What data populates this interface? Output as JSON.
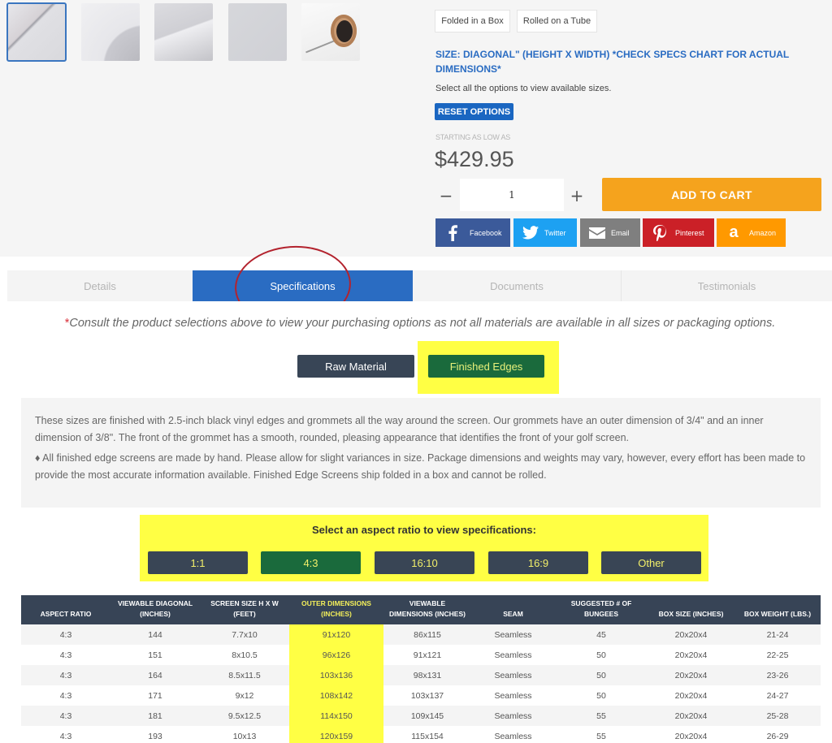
{
  "gallery": {
    "thumbnails": [
      {
        "alt": "folded screen material close-up",
        "active": true
      },
      {
        "alt": "screen material curl"
      },
      {
        "alt": "screen material fold"
      },
      {
        "alt": "screen material flat"
      },
      {
        "alt": "screen rolled on tube"
      }
    ]
  },
  "packaging": {
    "options": [
      "Folded in a Box",
      "Rolled on a Tube"
    ]
  },
  "size": {
    "heading": "SIZE: DIAGONAL\" (HEIGHT X WIDTH) *CHECK SPECS CHART FOR ACTUAL DIMENSIONS*",
    "note": "Select all the options to view available sizes.",
    "reset_label": "RESET OPTIONS"
  },
  "pricing": {
    "starting_label": "STARTING AS LOW AS",
    "price": "$429.95"
  },
  "quantity": {
    "minus": "−",
    "value": "1",
    "plus": "+"
  },
  "cart": {
    "add_label": "ADD TO CART",
    "color": "#f5a31d"
  },
  "share": [
    {
      "label": "Facebook",
      "icon": "facebook-icon",
      "color": "#3b5a9a"
    },
    {
      "label": "Twitter",
      "icon": "twitter-icon",
      "color": "#1da1f2"
    },
    {
      "label": "Email",
      "icon": "email-icon",
      "color": "#7f7f7f"
    },
    {
      "label": "Pinterest",
      "icon": "pinterest-icon",
      "color": "#cb2027"
    },
    {
      "label": "Amazon",
      "icon": "amazon-icon",
      "color": "#ff9900"
    }
  ],
  "tabs": [
    {
      "label": "Details"
    },
    {
      "label": "Specifications",
      "active": true
    },
    {
      "label": "Documents"
    },
    {
      "label": "Testimonials"
    }
  ],
  "consult": {
    "star": "*",
    "text": "Consult the product selections above to view your purchasing options as not all materials are available in all sizes or packaging options."
  },
  "materials": {
    "options": [
      "Raw Material",
      "Finished Edges"
    ],
    "selected": "Finished Edges"
  },
  "description": {
    "p1": "These sizes are finished with 2.5-inch black vinyl edges and grommets all the way around the screen. Our grommets have an outer dimension of 3/4\" and an inner dimension of 3/8\". The front of the grommet has a smooth, rounded, pleasing appearance that identifies the front of your golf screen.",
    "p2": "♦ All finished edge screens are made by hand. Please allow for slight variances in size. Package dimensions and weights may vary, however, every effort has been made to provide the most accurate information available. Finished Edge Screens ship folded in a box and cannot be rolled."
  },
  "aspect": {
    "title": "Select an aspect ratio to view specifications:",
    "options": [
      "1:1",
      "4:3",
      "16:10",
      "16:9",
      "Other"
    ],
    "selected": "4:3"
  },
  "spec_table": {
    "headers": [
      "ASPECT RATIO",
      "VIEWABLE DIAGONAL (INCHES)",
      "SCREEN SIZE H X W (FEET)",
      "OUTER DIMENSIONS (INCHES)",
      "VIEWABLE DIMENSIONS (INCHES)",
      "SEAM",
      "SUGGESTED # OF BUNGEES",
      "BOX SIZE (INCHES)",
      "BOX WEIGHT (LBS.)"
    ],
    "highlight_column": 3,
    "rows": [
      [
        "4:3",
        "144",
        "7.7x10",
        "91x120",
        "86x115",
        "Seamless",
        "45",
        "20x20x4",
        "21-24"
      ],
      [
        "4:3",
        "151",
        "8x10.5",
        "96x126",
        "91x121",
        "Seamless",
        "50",
        "20x20x4",
        "22-25"
      ],
      [
        "4:3",
        "164",
        "8.5x11.5",
        "103x136",
        "98x131",
        "Seamless",
        "50",
        "20x20x4",
        "23-26"
      ],
      [
        "4:3",
        "171",
        "9x12",
        "108x142",
        "103x137",
        "Seamless",
        "50",
        "20x20x4",
        "24-27"
      ],
      [
        "4:3",
        "181",
        "9.5x12.5",
        "114x150",
        "109x145",
        "Seamless",
        "55",
        "20x20x4",
        "25-28"
      ],
      [
        "4:3",
        "193",
        "10x13",
        "120x159",
        "115x154",
        "Seamless",
        "55",
        "20x20x4",
        "26-29"
      ]
    ]
  }
}
